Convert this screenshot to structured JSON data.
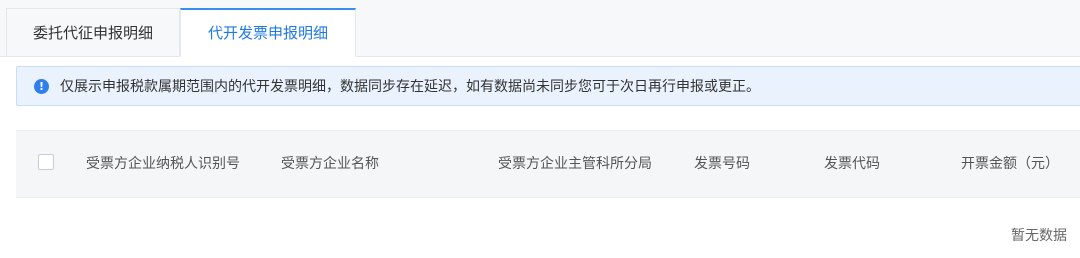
{
  "tabs": [
    {
      "label": "委托代征申报明细",
      "active": false
    },
    {
      "label": "代开发票申报明细",
      "active": true
    }
  ],
  "notice": {
    "icon": "info-icon",
    "icon_glyph": "!",
    "text": "仅展示申报税款属期范围内的代开发票明细，数据同步存在延迟，如有数据尚未同步您可于次日再行申报或更正。"
  },
  "table": {
    "columns": [
      "受票方企业纳税人识别号",
      "受票方企业名称",
      "受票方企业主管科所分局",
      "发票号码",
      "发票代码",
      "开票金额（元）"
    ],
    "rows": [],
    "empty_text": "暂无数据"
  },
  "colors": {
    "accent": "#1f7ae0",
    "notice_bg": "#eaf2fe",
    "info_icon": "#2f80ed"
  }
}
